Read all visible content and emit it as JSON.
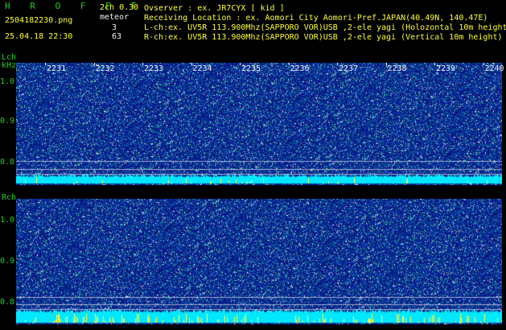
{
  "header": {
    "app_name": "H R O F F T",
    "mode": "2ch 0.30",
    "filename": "2504182230.png",
    "meteor_label": "meteor",
    "datetime": "25.04.18 22:30",
    "meteor_lch": "3",
    "meteor_rch": "63",
    "observer": "Ovserver          : ex. JR7CYX [ kid ]",
    "location": "Receiving Location : ex. Aomori City Aomori-Pref.JAPAN(40.49N, 140.47E)",
    "lch_info": "L-ch:ex. UV5R 113.900Mhz(SAPPORO VOR)USB ,2-ele yagi (Holozontal 10m height)",
    "rch_info": "R-ch:ex. UV5R 113.900Mhz(SAPPORO VOR)USB ,2-ele yagi (Vertical 10m height)"
  },
  "lch": {
    "label": "Lch",
    "unit": "kHz",
    "freq_ticks": [
      "1.0",
      "0.9",
      "0.8"
    ]
  },
  "rch": {
    "label": "Rch",
    "freq_ticks": [
      "1.0",
      "0.9",
      "0.8"
    ]
  },
  "time_ticks": [
    "2231",
    "2232",
    "2233",
    "2234",
    "2235",
    "2236",
    "2237",
    "2238",
    "2239",
    "2240"
  ],
  "colors": {
    "label_green": "#1ed21e",
    "label_yellow": "#ffff30",
    "spectrum_bg": "#0a1f8a",
    "carrier": "#00e8ff"
  }
}
